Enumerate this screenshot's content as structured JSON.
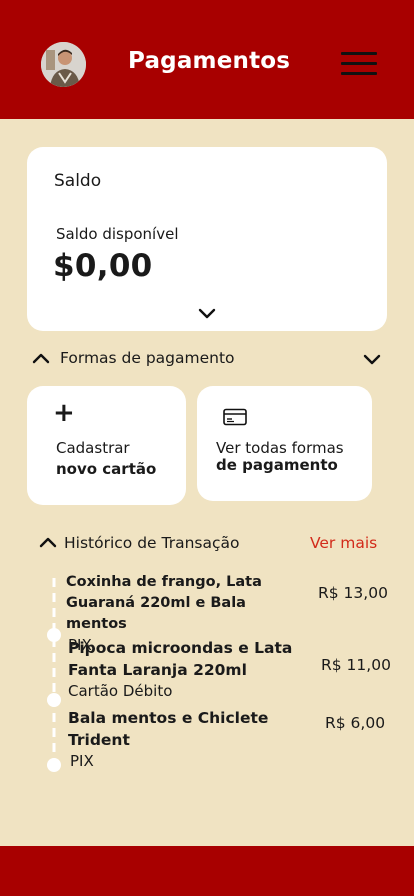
{
  "header": {
    "title": "Pagamentos",
    "menu_icon": "hamburger-menu-icon",
    "avatar_alt": "user-avatar"
  },
  "balance": {
    "title": "Saldo",
    "label": "Saldo disponível",
    "value": "$0,00",
    "expand_icon": "chevron-down-icon"
  },
  "payment_methods": {
    "label": "Formas de pagamento",
    "cards": [
      {
        "line1": "Cadastrar",
        "line2": "novo cartão",
        "icon": "plus-icon"
      },
      {
        "line1": "Ver todas formas",
        "line2": "de pagamento",
        "icon": "credit-card-icon"
      }
    ]
  },
  "history": {
    "label": "Histórico de Transação",
    "see_more": "Ver mais",
    "transactions": [
      {
        "name_line1": "Coxinha de frango, Lata",
        "name_line2": "Guaraná 220ml e Bala mentos",
        "method": "PIX",
        "amount": "R$ 13,00"
      },
      {
        "name_line1": "Pipoca microondas e Lata",
        "name_line2": "Fanta Laranja 220ml",
        "method": "Cartão Débito",
        "amount": "R$ 11,00"
      },
      {
        "name_line1": "Bala mentos e Chiclete",
        "name_line2": "Trident",
        "method": "PIX",
        "amount": "R$ 6,00"
      }
    ]
  },
  "colors": {
    "brand_red": "#a80000",
    "background": "#f0e3c2",
    "accent_link": "#d22b1a",
    "card": "#ffffff"
  }
}
